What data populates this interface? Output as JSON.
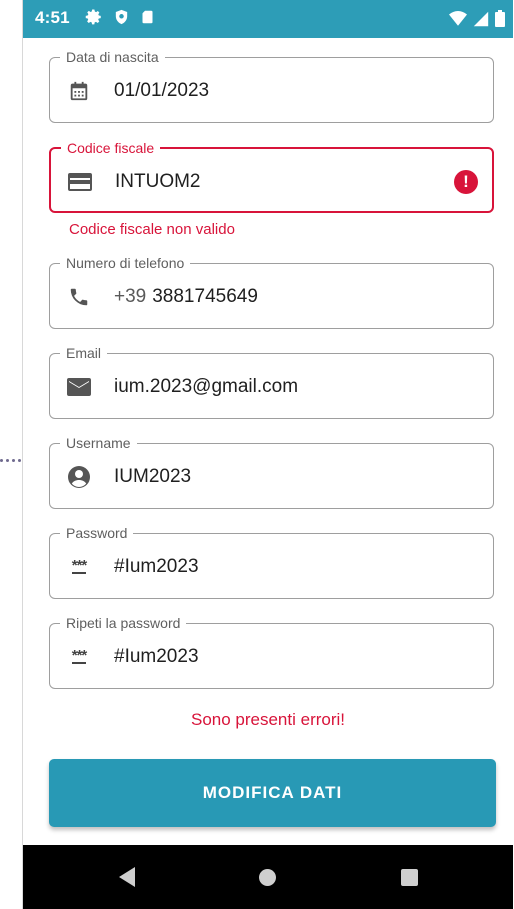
{
  "status_bar": {
    "time": "4:51"
  },
  "fields": [
    {
      "label": "Data di nascita",
      "value": "01/01/2023",
      "icon": "calendar-icon"
    },
    {
      "label": "Codice fiscale",
      "value": "INTUOM2",
      "icon": "card-icon",
      "error": true
    },
    {
      "label": "Numero di telefono",
      "prefix": "+39",
      "value": "3881745649",
      "icon": "phone-icon"
    },
    {
      "label": "Email",
      "value": "ium.2023@gmail.com",
      "icon": "mail-icon"
    },
    {
      "label": "Username",
      "value": "IUM2023",
      "icon": "account-icon"
    },
    {
      "label": "Password",
      "value": "#Ium2023",
      "icon": "password-icon",
      "icon_glyph": "***"
    },
    {
      "label": "Ripeti la password",
      "value": "#Ium2023",
      "icon": "password-icon",
      "icon_glyph": "***"
    }
  ],
  "error_icon_glyph": "!",
  "codice_fiscale_error": "Codice fiscale non valido",
  "form_error": "Sono presenti errori!",
  "submit_label": "MODIFICA DATI",
  "colors": {
    "primary": "#2899b5",
    "status_bar": "#2d9db7",
    "error": "#d8143a"
  }
}
